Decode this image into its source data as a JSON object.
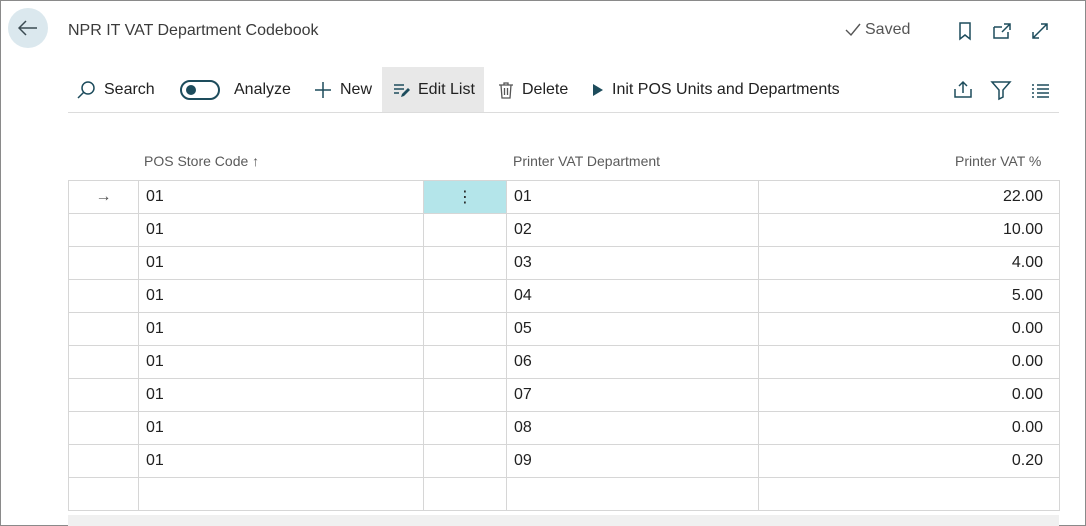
{
  "header": {
    "title": "NPR IT VAT Department Codebook",
    "saved_label": "Saved"
  },
  "toolbar": {
    "search": "Search",
    "analyze": "Analyze",
    "new": "New",
    "edit_list": "Edit List",
    "delete": "Delete",
    "init_pos": "Init POS Units and Departments"
  },
  "columns": {
    "pos_store_code": "POS Store Code",
    "printer_vat_department": "Printer VAT Department",
    "printer_vat_pct": "Printer VAT %"
  },
  "rows": [
    {
      "code": "01",
      "dept": "01",
      "pct": "22.00"
    },
    {
      "code": "01",
      "dept": "02",
      "pct": "10.00"
    },
    {
      "code": "01",
      "dept": "03",
      "pct": "4.00"
    },
    {
      "code": "01",
      "dept": "04",
      "pct": "5.00"
    },
    {
      "code": "01",
      "dept": "05",
      "pct": "0.00"
    },
    {
      "code": "01",
      "dept": "06",
      "pct": "0.00"
    },
    {
      "code": "01",
      "dept": "07",
      "pct": "0.00"
    },
    {
      "code": "01",
      "dept": "08",
      "pct": "0.00"
    },
    {
      "code": "01",
      "dept": "09",
      "pct": "0.20"
    }
  ],
  "sort_indicator": "↑",
  "row_marker": "→",
  "row_menu": "⋮",
  "colors": {
    "accent": "#1d4c5c",
    "selected_cell": "#b4e5ea",
    "back_button_bg": "#dbe8ee"
  }
}
